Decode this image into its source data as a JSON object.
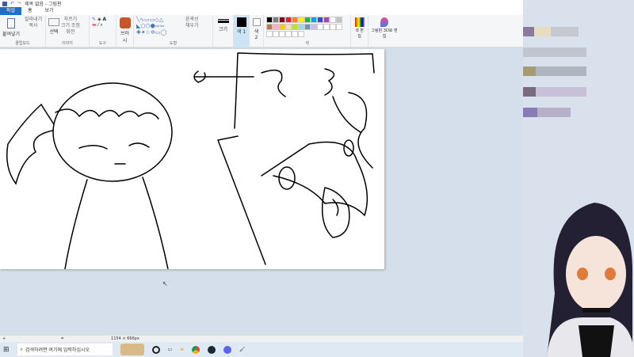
{
  "window": {
    "title": "제목 없음 - 그림판"
  },
  "tabs": [
    {
      "label": "파일"
    },
    {
      "label": "홈"
    },
    {
      "label": "보기"
    }
  ],
  "ribbon": {
    "clipboard": {
      "paste": "붙여넣기",
      "cut": "잘라내기",
      "copy": "복사",
      "label": "클립보드"
    },
    "image": {
      "select": "선택",
      "crop": "자르기",
      "resize": "크기 조정",
      "rotate": "회전",
      "label": "이미지"
    },
    "tools": {
      "label": "도구"
    },
    "brushes": {
      "label": "브러시"
    },
    "shapes": {
      "outline": "윤곽선",
      "fill": "채우기",
      "label": "도형"
    },
    "size": {
      "label": "크기"
    },
    "color1": {
      "label": "색 1"
    },
    "color2": {
      "label": "색 2"
    },
    "colors": {
      "label": "색",
      "edit": "색 편집",
      "palette": [
        "#000000",
        "#7f7f7f",
        "#880015",
        "#ed1c24",
        "#ff7f27",
        "#fff200",
        "#22b14c",
        "#00a2e8",
        "#3f48cc",
        "#a349a4",
        "#ffffff",
        "#c3c3c3",
        "#b97a57",
        "#ffaec9",
        "#ffc90e",
        "#efe4b0",
        "#b5e61d",
        "#99d9ea",
        "#7092be",
        "#c8bfe7"
      ]
    },
    "paint3d": {
      "label": "그림판 3D로 편집"
    }
  },
  "status": {
    "canvas_size": "1154 × 666px"
  },
  "taskbar": {
    "search_placeholder": "검색하려면 여기에 입력하십시오"
  }
}
